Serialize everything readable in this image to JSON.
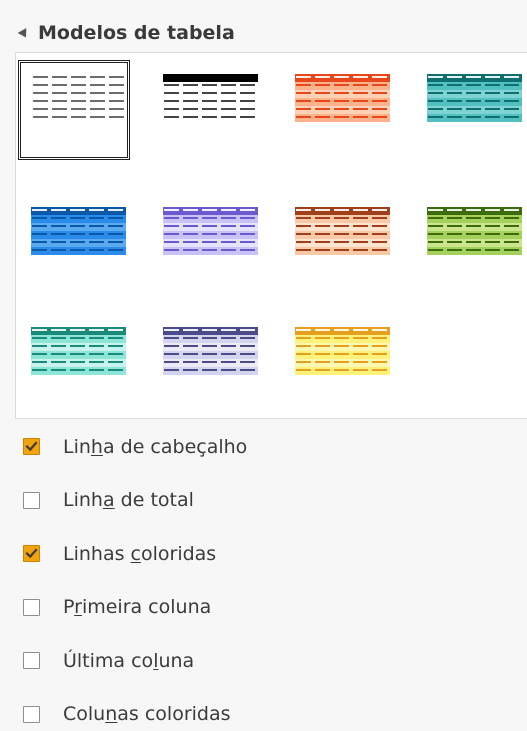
{
  "section": {
    "title": "Modelos de tabela"
  },
  "gallery": {
    "selected_index": 0,
    "styles": [
      {
        "name": "default",
        "header": "#6d6d6d",
        "line": "#5a5a5a",
        "fill": "#e6e6e6",
        "alt": "#ffffff"
      },
      {
        "name": "black",
        "header": "#000000",
        "line": "#333333",
        "fill": "#ffffff",
        "alt": "#ffffff"
      },
      {
        "name": "orange",
        "header": "#e8471c",
        "line": "#e8471c",
        "fill": "#fcb28a",
        "alt": "#ffd2b5"
      },
      {
        "name": "teal",
        "header": "#0f6f6f",
        "line": "#2aa3a3",
        "fill": "#52c0c0",
        "alt": "#7fd3d3"
      },
      {
        "name": "blue",
        "header": "#0b57a8",
        "line": "#1a6fcf",
        "fill": "#2a8bea",
        "alt": "#5aaaf0"
      },
      {
        "name": "lavender",
        "header": "#6a5acd",
        "line": "#7b6fe0",
        "fill": "#c8c2f5",
        "alt": "#e5e2fb"
      },
      {
        "name": "brown",
        "header": "#a0401a",
        "line": "#b85a2a",
        "fill": "#f7c9a6",
        "alt": "#fde4cf"
      },
      {
        "name": "olive",
        "header": "#3b6b0c",
        "line": "#5a8a1a",
        "fill": "#a6d05c",
        "alt": "#cbe58f"
      },
      {
        "name": "aqua",
        "header": "#1a8a7a",
        "line": "#2ab0a0",
        "fill": "#8ee6d8",
        "alt": "#c8f3ec"
      },
      {
        "name": "slate",
        "header": "#4b4b8a",
        "line": "#6a6aa8",
        "fill": "#d4d4ee",
        "alt": "#ececf8"
      },
      {
        "name": "yellow",
        "header": "#e5a020",
        "line": "#e5a020",
        "fill": "#fff27a",
        "alt": "#fff8b0"
      }
    ]
  },
  "options": [
    {
      "label_pre": "Lin",
      "label_u": "h",
      "label_post": "a de cabeçalho",
      "checked": true
    },
    {
      "label_pre": "Linh",
      "label_u": "a",
      "label_post": " de total",
      "checked": false
    },
    {
      "label_pre": "Linhas ",
      "label_u": "c",
      "label_post": "oloridas",
      "checked": true
    },
    {
      "label_pre": "P",
      "label_u": "r",
      "label_post": "imeira coluna",
      "checked": false
    },
    {
      "label_pre": "Última co",
      "label_u": "l",
      "label_post": "una",
      "checked": false
    },
    {
      "label_pre": "Colu",
      "label_u": "n",
      "label_post": "as coloridas",
      "checked": false
    }
  ]
}
